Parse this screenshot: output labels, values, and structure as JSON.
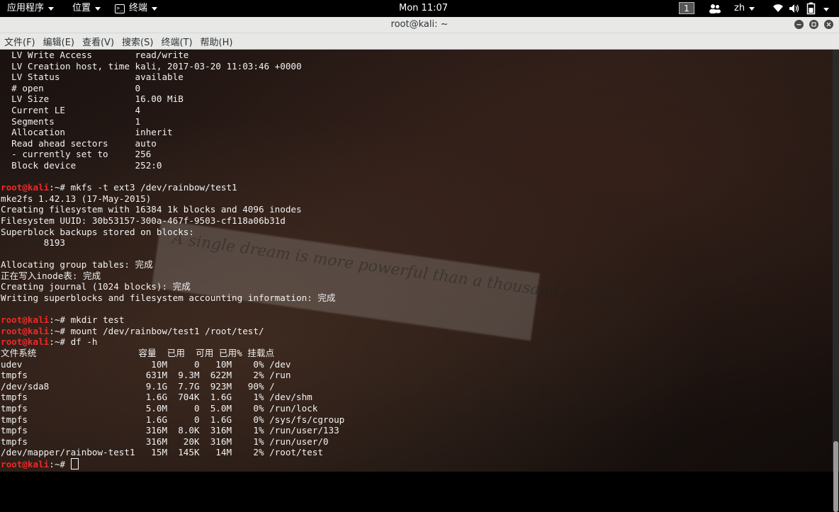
{
  "topbar": {
    "apps_label": "应用程序",
    "places_label": "位置",
    "terminal_label": "终端",
    "clock": "Mon 11:07",
    "workspace": "1",
    "input_method": "zh"
  },
  "window": {
    "title": "root@kali: ~"
  },
  "menubar": {
    "items": [
      "文件(F)",
      "编辑(E)",
      "查看(V)",
      "搜索(S)",
      "终端(T)",
      "帮助(H)"
    ]
  },
  "terminal": {
    "prompt_user": "root@kali",
    "prompt_rest": ":~#",
    "lines": [
      {
        "text": "  LV Write Access        read/write"
      },
      {
        "text": "  LV Creation host, time kali, 2017-03-20 11:03:46 +0000"
      },
      {
        "text": "  LV Status              available"
      },
      {
        "text": "  # open                 0"
      },
      {
        "text": "  LV Size                16.00 MiB"
      },
      {
        "text": "  Current LE             4"
      },
      {
        "text": "  Segments               1"
      },
      {
        "text": "  Allocation             inherit"
      },
      {
        "text": "  Read ahead sectors     auto"
      },
      {
        "text": "  - currently set to     256"
      },
      {
        "text": "  Block device           252:0"
      },
      {
        "text": ""
      },
      {
        "prompt": true,
        "text": " mkfs -t ext3 /dev/rainbow/test1"
      },
      {
        "text": "mke2fs 1.42.13 (17-May-2015)"
      },
      {
        "text": "Creating filesystem with 16384 1k blocks and 4096 inodes"
      },
      {
        "text": "Filesystem UUID: 30b53157-300a-467f-9503-cf118a06b31d"
      },
      {
        "text": "Superblock backups stored on blocks:"
      },
      {
        "text": "        8193"
      },
      {
        "text": ""
      },
      {
        "text": "Allocating group tables: 完成"
      },
      {
        "text": "正在写入inode表: 完成"
      },
      {
        "text": "Creating journal (1024 blocks): 完成"
      },
      {
        "text": "Writing superblocks and filesystem accounting information: 完成"
      },
      {
        "text": ""
      },
      {
        "prompt": true,
        "text": " mkdir test"
      },
      {
        "prompt": true,
        "text": " mount /dev/rainbow/test1 /root/test/"
      },
      {
        "prompt": true,
        "text": " df -h"
      },
      {
        "text": "文件系统                   容量  已用  可用 已用% 挂载点"
      },
      {
        "text": "udev                        10M     0   10M    0% /dev"
      },
      {
        "text": "tmpfs                      631M  9.3M  622M    2% /run"
      },
      {
        "text": "/dev/sda8                  9.1G  7.7G  923M   90% /"
      },
      {
        "text": "tmpfs                      1.6G  704K  1.6G    1% /dev/shm"
      },
      {
        "text": "tmpfs                      5.0M     0  5.0M    0% /run/lock"
      },
      {
        "text": "tmpfs                      1.6G     0  1.6G    0% /sys/fs/cgroup"
      },
      {
        "text": "tmpfs                      316M  8.0K  316M    1% /run/user/133"
      },
      {
        "text": "tmpfs                      316M   20K  316M    1% /run/user/0"
      },
      {
        "text": "/dev/mapper/rainbow-test1   15M  145K   14M    2% /root/test"
      },
      {
        "prompt": true,
        "cursor": true,
        "text": " "
      }
    ]
  },
  "wallpaper": {
    "note_text": "\"A single dream is more powerful than a thousand realities.\""
  }
}
